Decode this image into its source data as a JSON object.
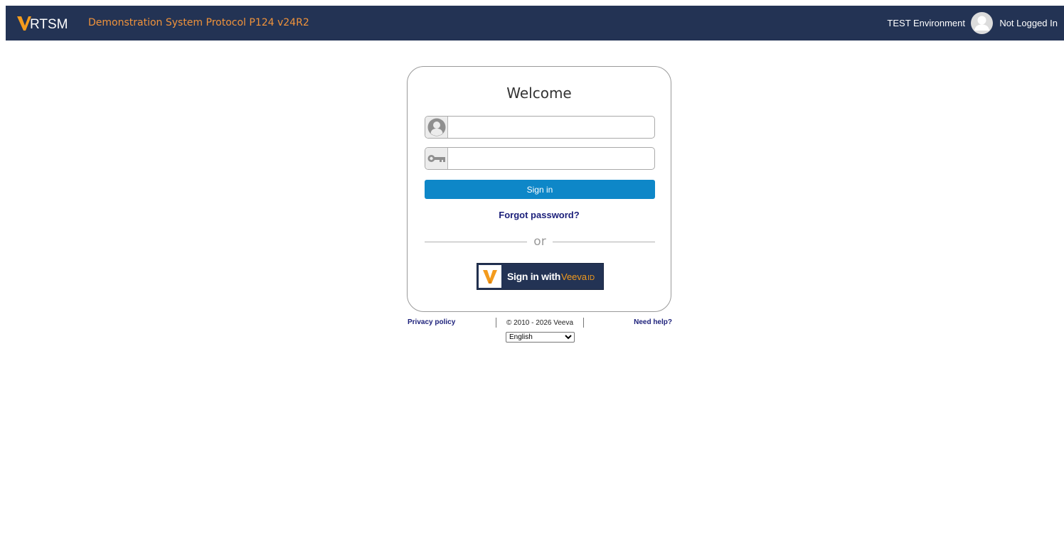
{
  "header": {
    "logo_text": "RTSM",
    "study_title": "Demonstration System Protocol P124 v24R2",
    "environment": "TEST Environment",
    "login_status": "Not Logged In",
    "colors": {
      "bar": "#233354",
      "accent": "#f0933b"
    }
  },
  "login": {
    "title": "Welcome",
    "username": {
      "value": "",
      "icon": "user-icon"
    },
    "password": {
      "value": "",
      "icon": "key-icon"
    },
    "sign_in_label": "Sign in",
    "forgot_password": "Forgot password?",
    "or_text": "or",
    "veeva_sign_in": {
      "label": "Sign in with",
      "brand": "Veeva",
      "brand_suffix": "ID"
    }
  },
  "footer": {
    "privacy": "Privacy policy",
    "copyright": "© 2010 - 2026 Veeva",
    "help": "Need help?",
    "language": {
      "selected": "English",
      "options": [
        "English"
      ]
    }
  }
}
